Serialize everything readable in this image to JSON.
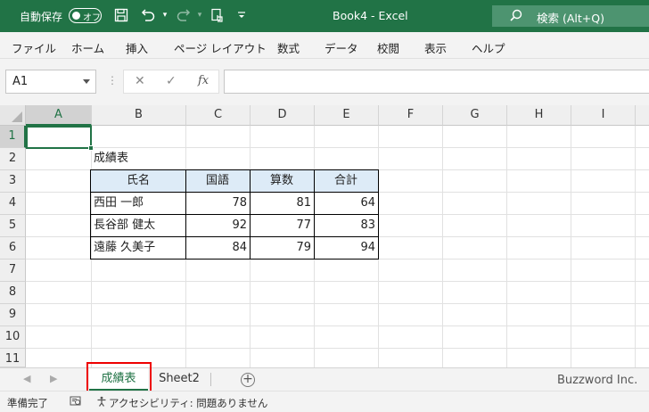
{
  "titlebar": {
    "autosave_label": "自動保存",
    "autosave_state": "オフ",
    "doc_title": "Book4  -  Excel",
    "search_placeholder": "検索 (Alt+Q)",
    "icons": [
      "save-icon",
      "undo-icon",
      "redo-icon",
      "touch-mode-icon",
      "customize-icon"
    ]
  },
  "ribbon": {
    "tabs": [
      "ファイル",
      "ホーム",
      "挿入",
      "ページ レイアウト",
      "数式",
      "データ",
      "校閲",
      "表示",
      "ヘルプ"
    ]
  },
  "formula_bar": {
    "name_box": "A1",
    "formula": "",
    "fx_label": "fx"
  },
  "grid": {
    "columns": [
      "A",
      "B",
      "C",
      "D",
      "E",
      "F",
      "G",
      "H",
      "I"
    ],
    "rows": [
      "1",
      "2",
      "3",
      "4",
      "5",
      "6",
      "7",
      "8",
      "9",
      "10",
      "11"
    ],
    "selected_cell": "A1",
    "cells": {
      "B2": "成績表",
      "B3": "氏名",
      "C3": "国語",
      "D3": "算数",
      "E3": "合計",
      "B4": "西田 一郎",
      "C4": "78",
      "D4": "81",
      "E4": "64",
      "B5": "長谷部 健太",
      "C5": "92",
      "D5": "77",
      "E5": "83",
      "B6": "遠藤 久美子",
      "C6": "84",
      "D6": "79",
      "E6": "94"
    },
    "header_fill": "#ddebf7"
  },
  "sheets": {
    "tabs": [
      "成績表",
      "Sheet2"
    ],
    "active": "成績表",
    "watermark": "Buzzword Inc."
  },
  "statusbar": {
    "ready": "準備完了",
    "accessibility": "アクセシビリティ: 問題ありません"
  },
  "colors": {
    "excel_green": "#217346",
    "highlight_red": "#e00000"
  }
}
